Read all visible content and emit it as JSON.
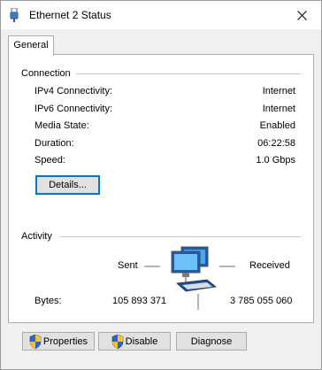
{
  "window": {
    "title": "Ethernet 2 Status"
  },
  "tabs": [
    {
      "label": "General"
    }
  ],
  "connection": {
    "title": "Connection",
    "rows": [
      {
        "label": "IPv4 Connectivity:",
        "value": "Internet"
      },
      {
        "label": "IPv6 Connectivity:",
        "value": "Internet"
      },
      {
        "label": "Media State:",
        "value": "Enabled"
      },
      {
        "label": "Duration:",
        "value": "06:22:58"
      },
      {
        "label": "Speed:",
        "value": "1.0 Gbps"
      }
    ],
    "details_label": "Details..."
  },
  "activity": {
    "title": "Activity",
    "sent_label": "Sent",
    "received_label": "Received",
    "bytes_label": "Bytes:",
    "bytes_sent": "105 893 371",
    "bytes_received": "3 785 055 060"
  },
  "buttons": {
    "properties": "Properties",
    "disable": "Disable",
    "diagnose": "Diagnose"
  },
  "icons": {
    "title": "network-adapter-icon",
    "close": "close-icon",
    "activity": "network-computers-icon",
    "shield": "uac-shield-icon"
  },
  "colors": {
    "accent": "#0078d7"
  }
}
